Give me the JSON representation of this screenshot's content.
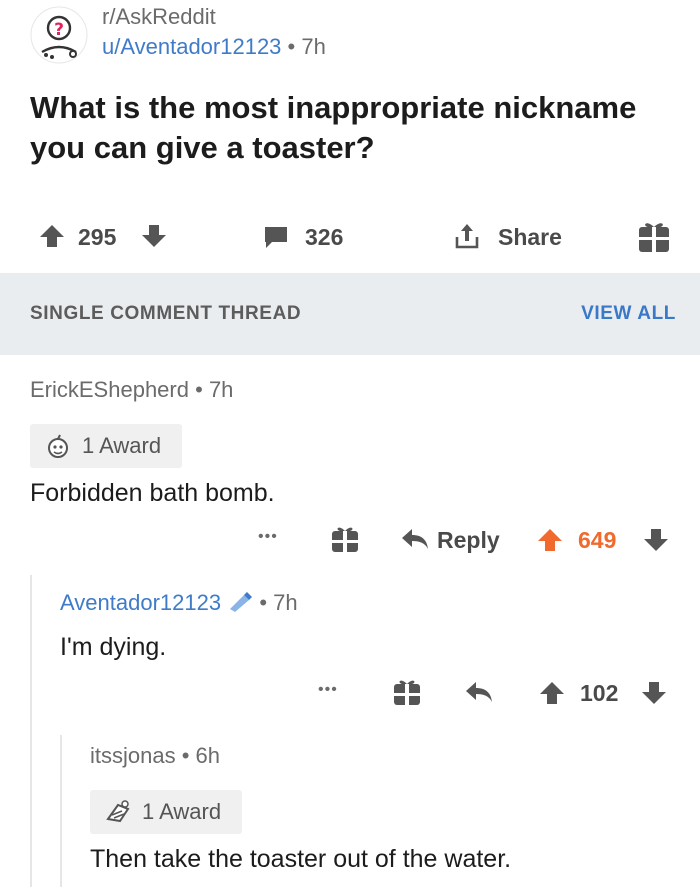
{
  "post": {
    "subreddit": "r/AskReddit",
    "author": "u/Aventador12123",
    "separator": "•",
    "age": "7h",
    "title": "What is the most inappropriate nickname you can give a toaster?",
    "score": "295",
    "comment_count": "326",
    "share_label": "Share"
  },
  "thread_bar": {
    "label": "SINGLE COMMENT THREAD",
    "view_all": "VIEW ALL"
  },
  "comments": [
    {
      "author": "ErickEShepherd",
      "age": "7h",
      "award": "1 Award",
      "body": "Forbidden bath bomb.",
      "more": "•••",
      "reply_label": "Reply",
      "score": "649"
    },
    {
      "author": "Aventador12123",
      "age": "7h",
      "body": "I'm dying.",
      "more": "•••",
      "score": "102"
    },
    {
      "author": "itssjonas",
      "age": "6h",
      "award": "1 Award",
      "body": "Then take the toaster out of the water."
    }
  ],
  "colors": {
    "link_blue": "#3f7bc8",
    "upvote_orange": "#f06a2e",
    "band_bg": "#e9edef"
  },
  "icons": [
    "askreddit-avatar",
    "upvote-icon",
    "downvote-icon",
    "comment-icon",
    "share-icon",
    "gift-icon",
    "reply-icon",
    "award-icon",
    "op-pencil-icon"
  ]
}
